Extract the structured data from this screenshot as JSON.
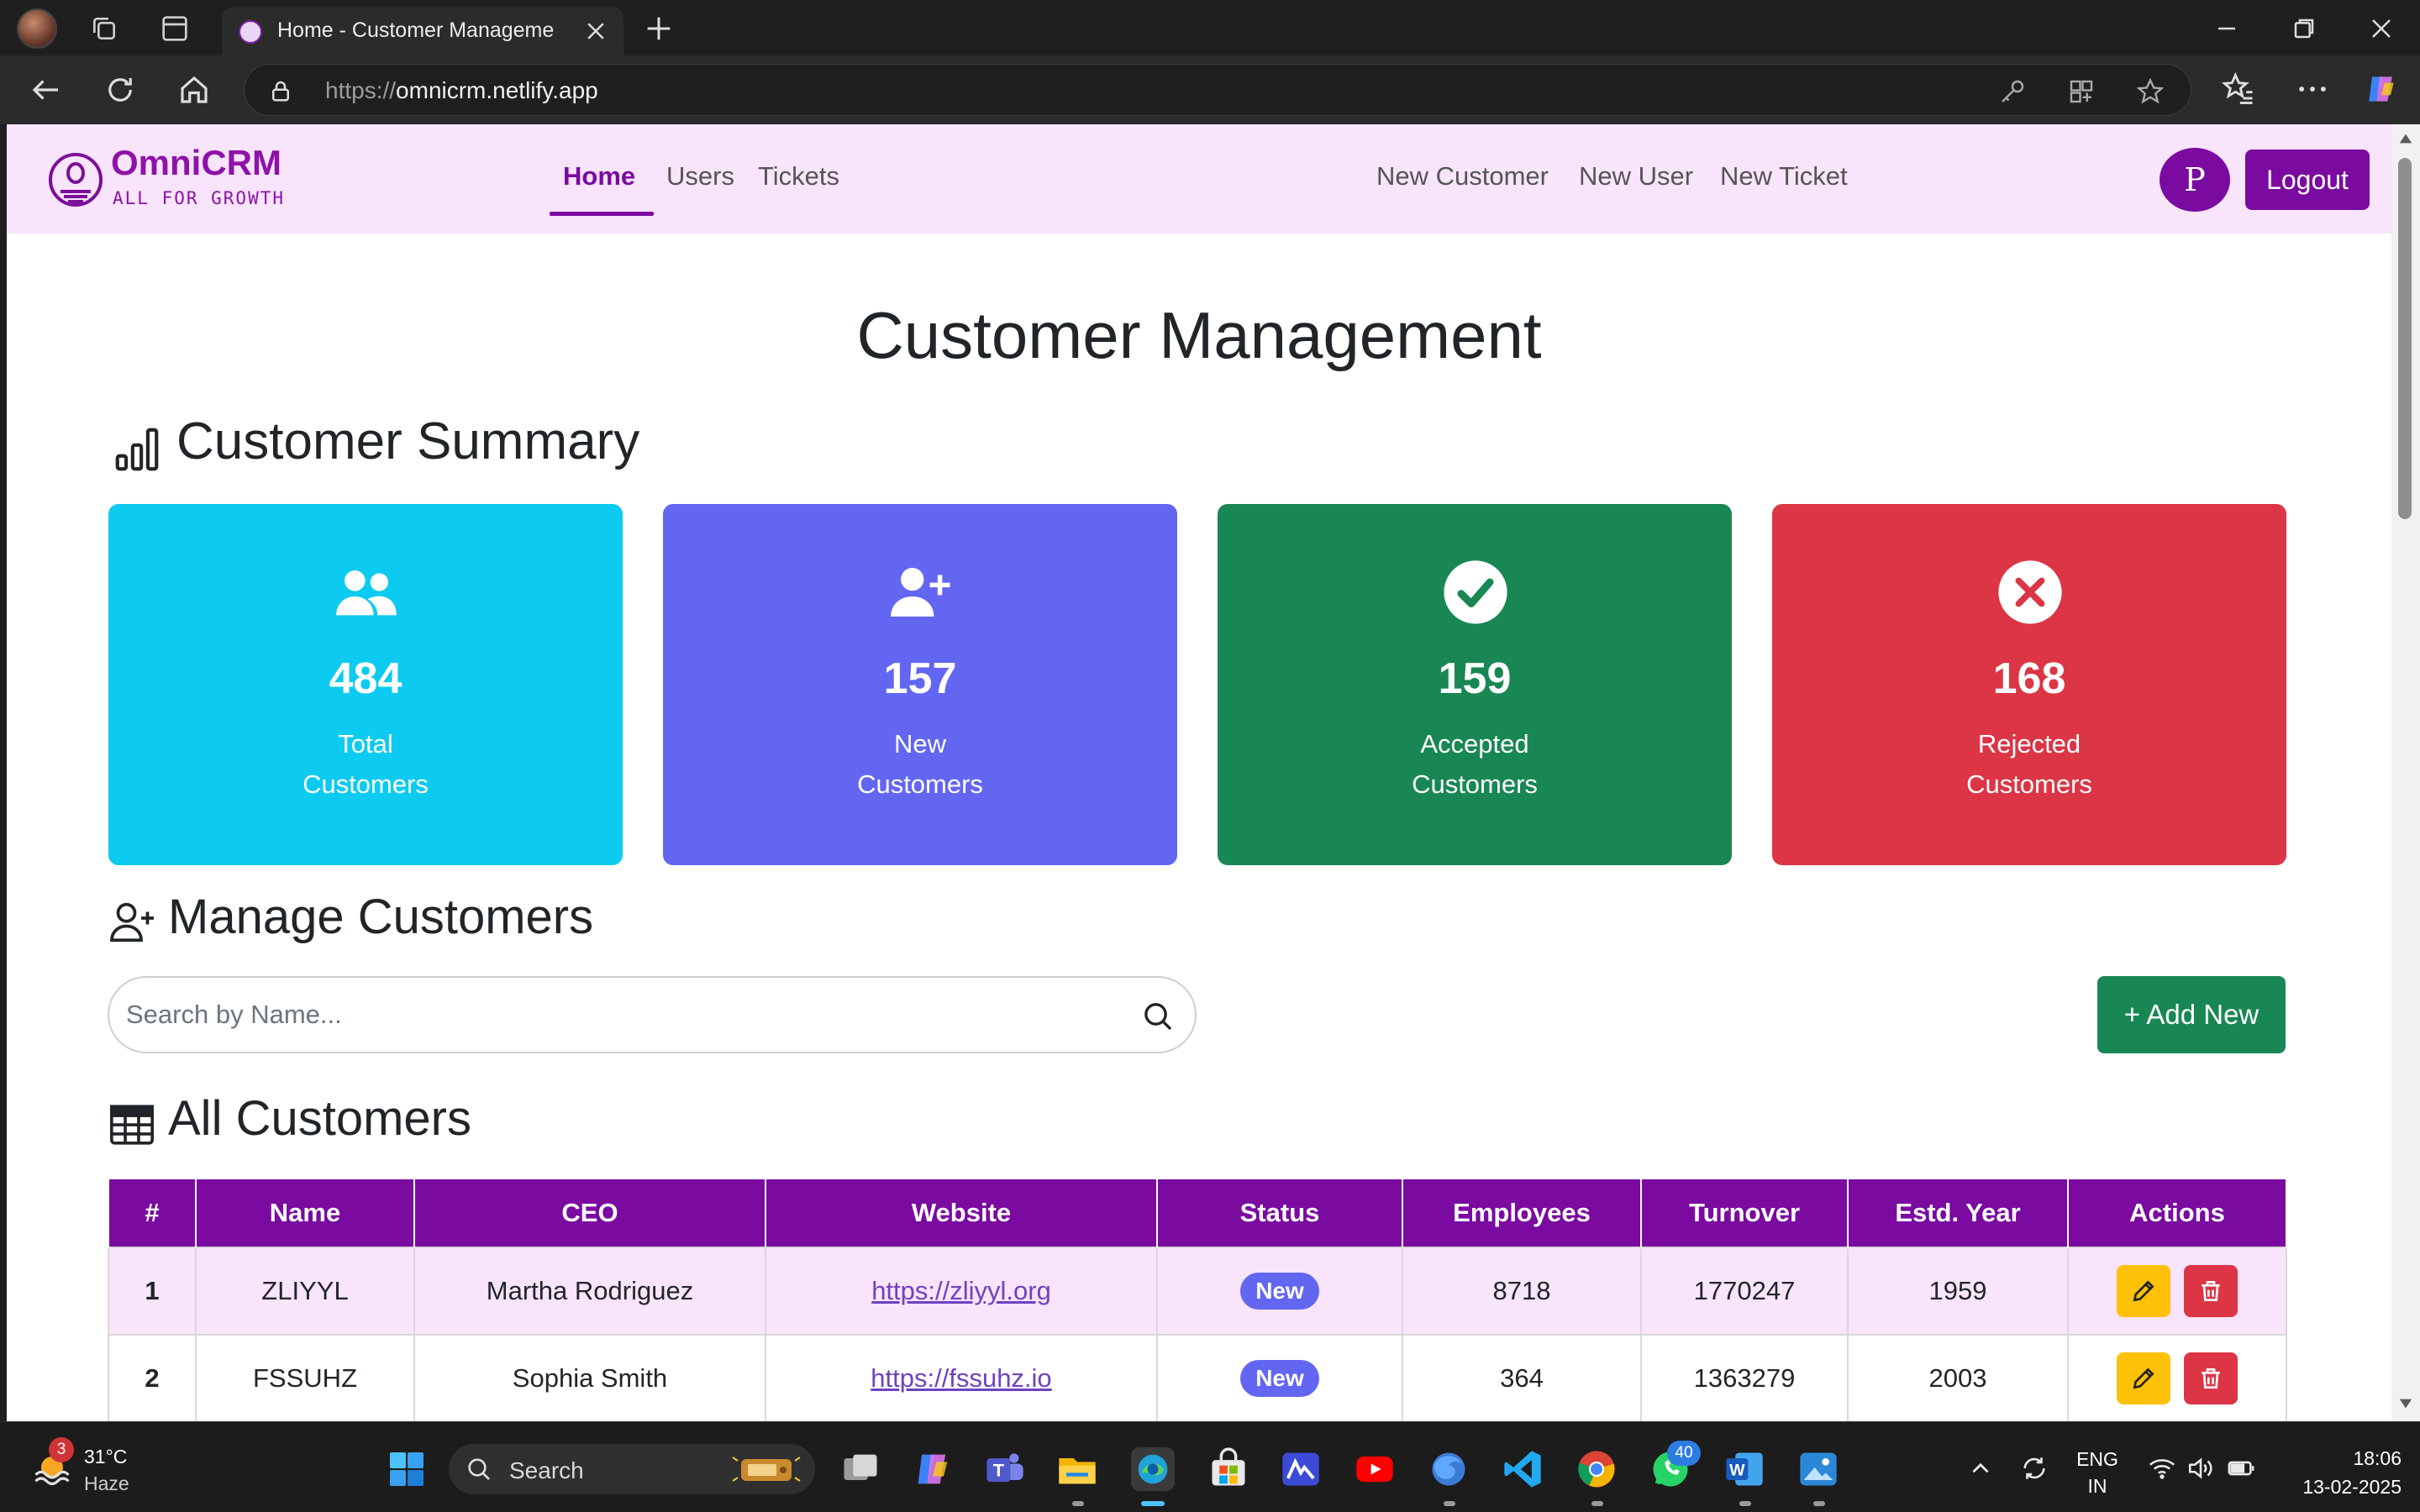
{
  "browser": {
    "tab_title": "Home - Customer Management |",
    "url_scheme": "https://",
    "url_host": "omnicrm.netlify.app"
  },
  "app": {
    "logo_name": "OmniCRM",
    "logo_tagline": "ALL FOR GROWTH",
    "nav_left": [
      "Home",
      "Users",
      "Tickets"
    ],
    "nav_right": [
      "New Customer",
      "New User",
      "New Ticket"
    ],
    "profile_initial": "P",
    "logout_label": "Logout",
    "brand_color": "#7a0aa0"
  },
  "page": {
    "title": "Customer Management",
    "summary_title": "Customer Summary",
    "manage_title": "Manage Customers",
    "all_title": "All Customers",
    "search_placeholder": "Search by Name...",
    "add_new_label": "+ Add New"
  },
  "summary_cards": [
    {
      "value": "484",
      "line1": "Total",
      "line2": "Customers",
      "color": "#0dcaf0",
      "icon": "users-icon"
    },
    {
      "value": "157",
      "line1": "New",
      "line2": "Customers",
      "color": "#6366f1",
      "icon": "user-plus-icon"
    },
    {
      "value": "159",
      "line1": "Accepted",
      "line2": "Customers",
      "color": "#198754",
      "icon": "check-circle-icon"
    },
    {
      "value": "168",
      "line1": "Rejected",
      "line2": "Customers",
      "color": "#dc3545",
      "icon": "x-circle-icon"
    }
  ],
  "table": {
    "headers": [
      "#",
      "Name",
      "CEO",
      "Website",
      "Status",
      "Employees",
      "Turnover",
      "Estd. Year",
      "Actions"
    ],
    "rows": [
      {
        "idx": "1",
        "name": "ZLIYYL",
        "ceo": "Martha Rodriguez",
        "website": "https://zliyyl.org",
        "status": "New",
        "employees": "8718",
        "turnover": "1770247",
        "year": "1959"
      },
      {
        "idx": "2",
        "name": "FSSUHZ",
        "ceo": "Sophia Smith",
        "website": "https://fssuhz.io",
        "status": "New",
        "employees": "364",
        "turnover": "1363279",
        "year": "2003"
      }
    ]
  },
  "taskbar": {
    "weather_temp": "31°C",
    "weather_desc": "Haze",
    "weather_badge": "3",
    "search_label": "Search",
    "whatsapp_badge": "40",
    "lang_line1": "ENG",
    "lang_line2": "IN",
    "time": "18:06",
    "date": "13-02-2025"
  }
}
